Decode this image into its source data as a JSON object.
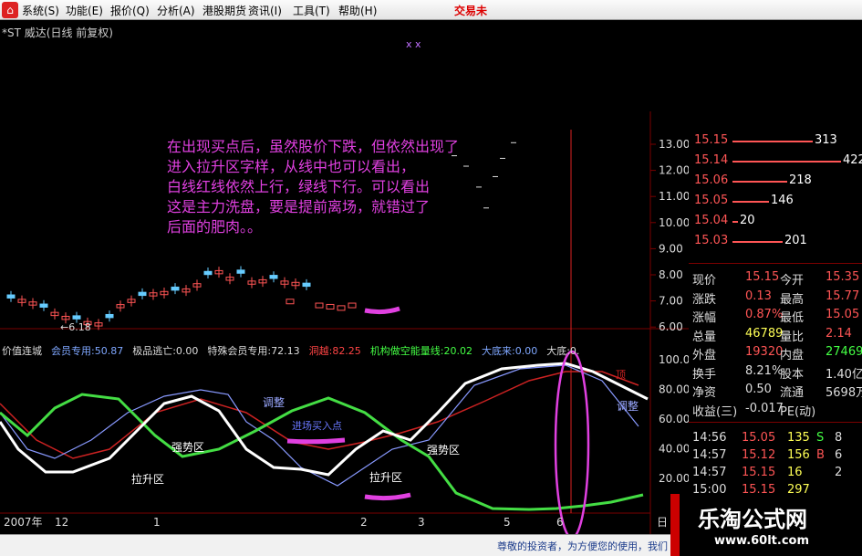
{
  "menu": {
    "logo": "⌂",
    "items": [
      "系统(S)",
      "功能(E)",
      "报价(Q)",
      "分析(A)",
      "港股期货",
      "资讯(I)",
      "工具(T)",
      "帮助(H)"
    ],
    "brand": "交易未"
  },
  "chart": {
    "title": "*ST 威达(日线 前复权)",
    "markers": "ⅹ  ⅹ",
    "annotation_lines": [
      "在出现买点后，虽然股价下跌，但依然出现了",
      "进入拉升区字样，从线中也可以看出，",
      "白线红线依然上行，绿线下行。可以看出",
      "这是主力洗盘，要是提前离场，就错过了",
      "后面的肥肉。。"
    ],
    "price_low_label": "←6.18",
    "y_axis_labels": [
      "13.00",
      "12.00",
      "11.00",
      "10.00",
      "9.00",
      "8.00",
      "7.00",
      "6.00"
    ],
    "indicator_header": [
      {
        "text": "价值连城",
        "color": "#dddddd"
      },
      {
        "text": "会员专用:50.87",
        "color": "#7fa7ff"
      },
      {
        "text": "极品逃亡:0.00",
        "color": "#dddddd"
      },
      {
        "text": "特殊会员专用:72.13",
        "color": "#dddddd"
      },
      {
        "text": "洞越:82.25",
        "color": "#ff4444"
      },
      {
        "text": "机构做空能量线:20.02",
        "color": "#44ff44"
      },
      {
        "text": "大底来:0.00",
        "color": "#7fa7ff"
      },
      {
        "text": "大底:0.",
        "color": "#dddddd"
      }
    ],
    "indicator_y_labels": [
      "100.0",
      "80.00",
      "60.00",
      "40.00",
      "20.00"
    ],
    "indicator_labels": {
      "tiaozheng1": "调整",
      "tiaozheng2": "调整",
      "qiangshi1": "强势区",
      "qiangshi2": "强势区",
      "lasheng1": "拉升区",
      "lasheng2": "拉升区",
      "buy_point": "进场买入点",
      "ding": "顶"
    },
    "x_axis_labels": [
      "2007年",
      "12",
      "1",
      "2",
      "3",
      "5",
      "6"
    ],
    "x_axis_right": "日"
  },
  "order_book": [
    {
      "price": "15.15",
      "qty": "313",
      "bar_fraction": 0.7
    },
    {
      "price": "15.14",
      "qty": "422",
      "bar_fraction": 0.95
    },
    {
      "price": "15.06",
      "qty": "218",
      "bar_fraction": 0.48
    },
    {
      "price": "15.05",
      "qty": "146",
      "bar_fraction": 0.32
    },
    {
      "price": "15.04",
      "qty": "20",
      "bar_fraction": 0.05
    },
    {
      "price": "15.03",
      "qty": "201",
      "bar_fraction": 0.44
    }
  ],
  "quote": [
    {
      "l1": "现价",
      "v1": "15.15",
      "c1": "#ff5555",
      "l2": "今开",
      "v2": "15.35",
      "c2": "#ff5555"
    },
    {
      "l1": "涨跌",
      "v1": "0.13",
      "c1": "#ff5555",
      "l2": "最高",
      "v2": "15.77",
      "c2": "#ff5555"
    },
    {
      "l1": "涨幅",
      "v1": "0.87%",
      "c1": "#ff5555",
      "l2": "最低",
      "v2": "15.05",
      "c2": "#ff5555"
    },
    {
      "l1": "总量",
      "v1": "46789",
      "c1": "#ffff55",
      "l2": "量比",
      "v2": "2.14",
      "c2": "#ff5555"
    },
    {
      "l1": "外盘",
      "v1": "19320",
      "c1": "#ff5555",
      "l2": "内盘",
      "v2": "27469",
      "c2": "#44ff44"
    },
    {
      "l1": "换手",
      "v1": "8.21%",
      "c1": "#dddddd",
      "l2": "股本",
      "v2": "1.40亿",
      "c2": "#dddddd"
    },
    {
      "l1": "净资",
      "v1": "0.50",
      "c1": "#dddddd",
      "l2": "流通",
      "v2": "5698万",
      "c2": "#dddddd"
    },
    {
      "l1": "收益(三)",
      "v1": "-0.017",
      "c1": "#dddddd",
      "l2": "PE(动)",
      "v2": "",
      "c2": "#dddddd"
    }
  ],
  "ticks": [
    {
      "time": "14:56",
      "price": "15.05",
      "vol": "135",
      "side": "S",
      "side_color": "#44ff44",
      "extra": "8"
    },
    {
      "time": "14:57",
      "price": "15.12",
      "vol": "156",
      "side": "B",
      "side_color": "#ff5555",
      "extra": "6"
    },
    {
      "time": "14:57",
      "price": "15.15",
      "vol": "16",
      "side": "",
      "side_color": "#dddddd",
      "extra": "2"
    },
    {
      "time": "15:00",
      "price": "15.15",
      "vol": "297",
      "side": "",
      "side_color": "#dddddd",
      "extra": ""
    }
  ],
  "status": {
    "text": "尊敬的投资者，为方便您的使用，我们"
  },
  "watermark": {
    "title": "乐淘公式网",
    "url": "www.60lt.com"
  },
  "colors": {
    "up": "#ff5555",
    "down": "#44ff44",
    "white_line": "#ffffff",
    "green_line": "#44dd44",
    "red_line": "#cc2222",
    "blue_line": "#8899ff",
    "annotation": "#e040e0"
  }
}
